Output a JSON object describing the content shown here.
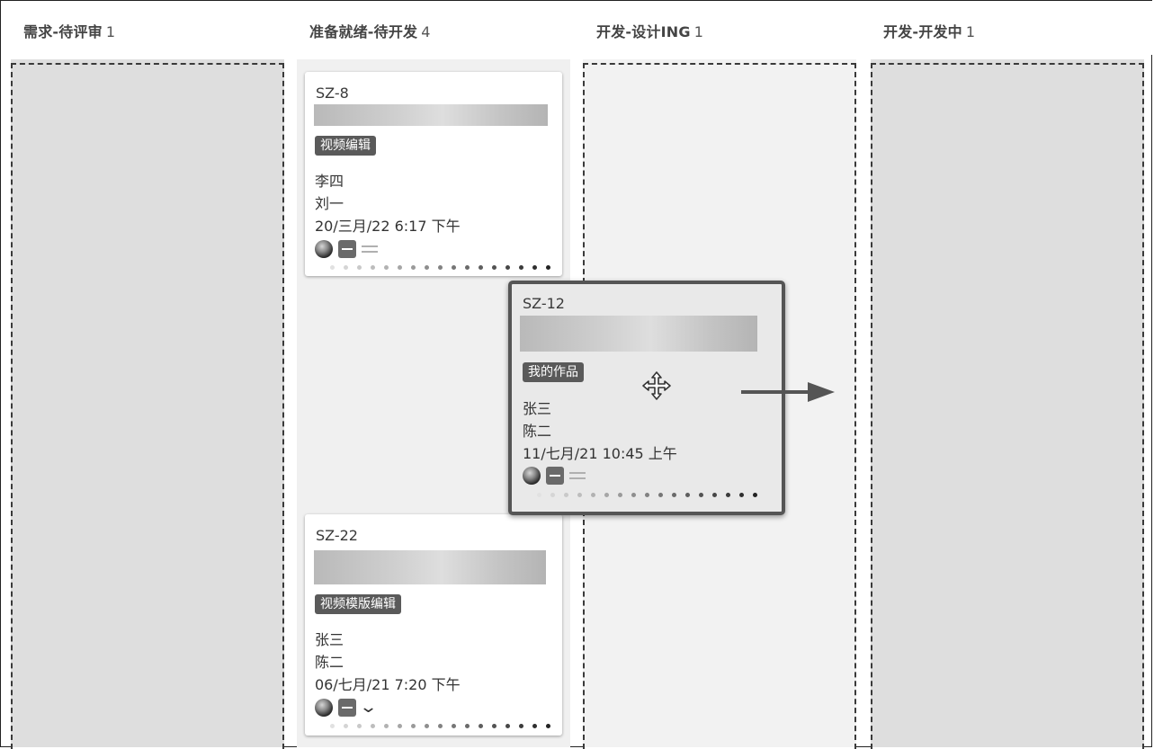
{
  "columns": [
    {
      "title": "需求-待评审",
      "count": "1"
    },
    {
      "title": "准备就绪-待开发",
      "count": "4"
    },
    {
      "title": "开发-设计ING",
      "count": "1"
    },
    {
      "title": "开发-开发中",
      "count": "1"
    }
  ],
  "cards": {
    "sz8": {
      "key": "SZ-8",
      "tag": "视频编辑",
      "assignee": "李四",
      "reporter": "刘一",
      "date": "20/三月/22 6:17 下午"
    },
    "sz22": {
      "key": "SZ-22",
      "tag": "视频模版编辑",
      "assignee": "张三",
      "reporter": "陈二",
      "date": "06/七月/21 7:20 下午"
    },
    "sz12": {
      "key": "SZ-12",
      "tag": "我的作品",
      "assignee": "张三",
      "reporter": "陈二",
      "date": "11/七月/21 10:45 上午"
    }
  },
  "icons": {
    "globe": "globe-icon",
    "priority": "priority-medium-icon",
    "drag": "move-icon",
    "arrow": "arrow-right-icon",
    "chevron": "chevron-down-icon",
    "lines": "priority-lines-icon"
  }
}
